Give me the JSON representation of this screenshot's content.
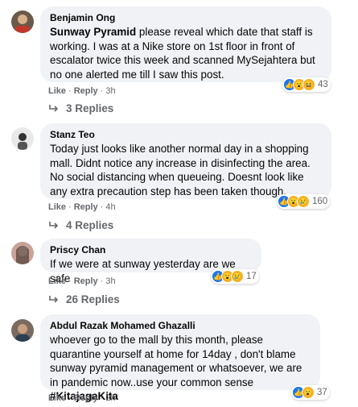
{
  "comments": [
    {
      "author": "Benjamin Ong",
      "mention": "Sunway Pyramid",
      "text": " please reveal which date that staff is working. I was at a Nike store on 1st floor in front of escalator twice this week and scanned MySejahtera but no one alerted me till I saw this post.",
      "reaction_count": "43",
      "like_label": "Like",
      "reply_label": "Reply",
      "time": "3h",
      "replies_label": "3 Replies"
    },
    {
      "author": "Stanz Teo",
      "text": "Today just looks like another normal day in a shopping mall. Didnt notice any increase in disinfecting the area. No social distancing when queueing. Doesnt look like any extra precaution step has been taken though.",
      "reaction_count": "160",
      "like_label": "Like",
      "reply_label": "Reply",
      "time": "4h",
      "replies_label": "4 Replies"
    },
    {
      "author": "Priscy Chan",
      "text": "If we were at sunway yesterday are we safe",
      "reaction_count": "17",
      "like_label": "Like",
      "reply_label": "Reply",
      "time": "3h",
      "replies_label": "26 Replies"
    },
    {
      "author": "Abdul Razak Mohamed Ghazalli",
      "text": "whoever go to the mall by this month, please quarantine yourself at home for 14day , don't blame sunway pyramid management or whatsoever, we are in pandemic now..use your common sense ",
      "hashtag": "#KitajagaKita",
      "reaction_count": "37",
      "like_label": "Like",
      "reply_label": "Reply",
      "time": "2h"
    }
  ],
  "separator": "·",
  "colors": {
    "bubble": "#f0f2f5",
    "secondary_text": "#65676b",
    "like_blue": "#1877f2",
    "emoji_yellow": "#f7b125"
  },
  "icons": [
    "like-icon",
    "wow-icon",
    "sad-icon",
    "haha-icon",
    "reply-arrow-icon"
  ]
}
